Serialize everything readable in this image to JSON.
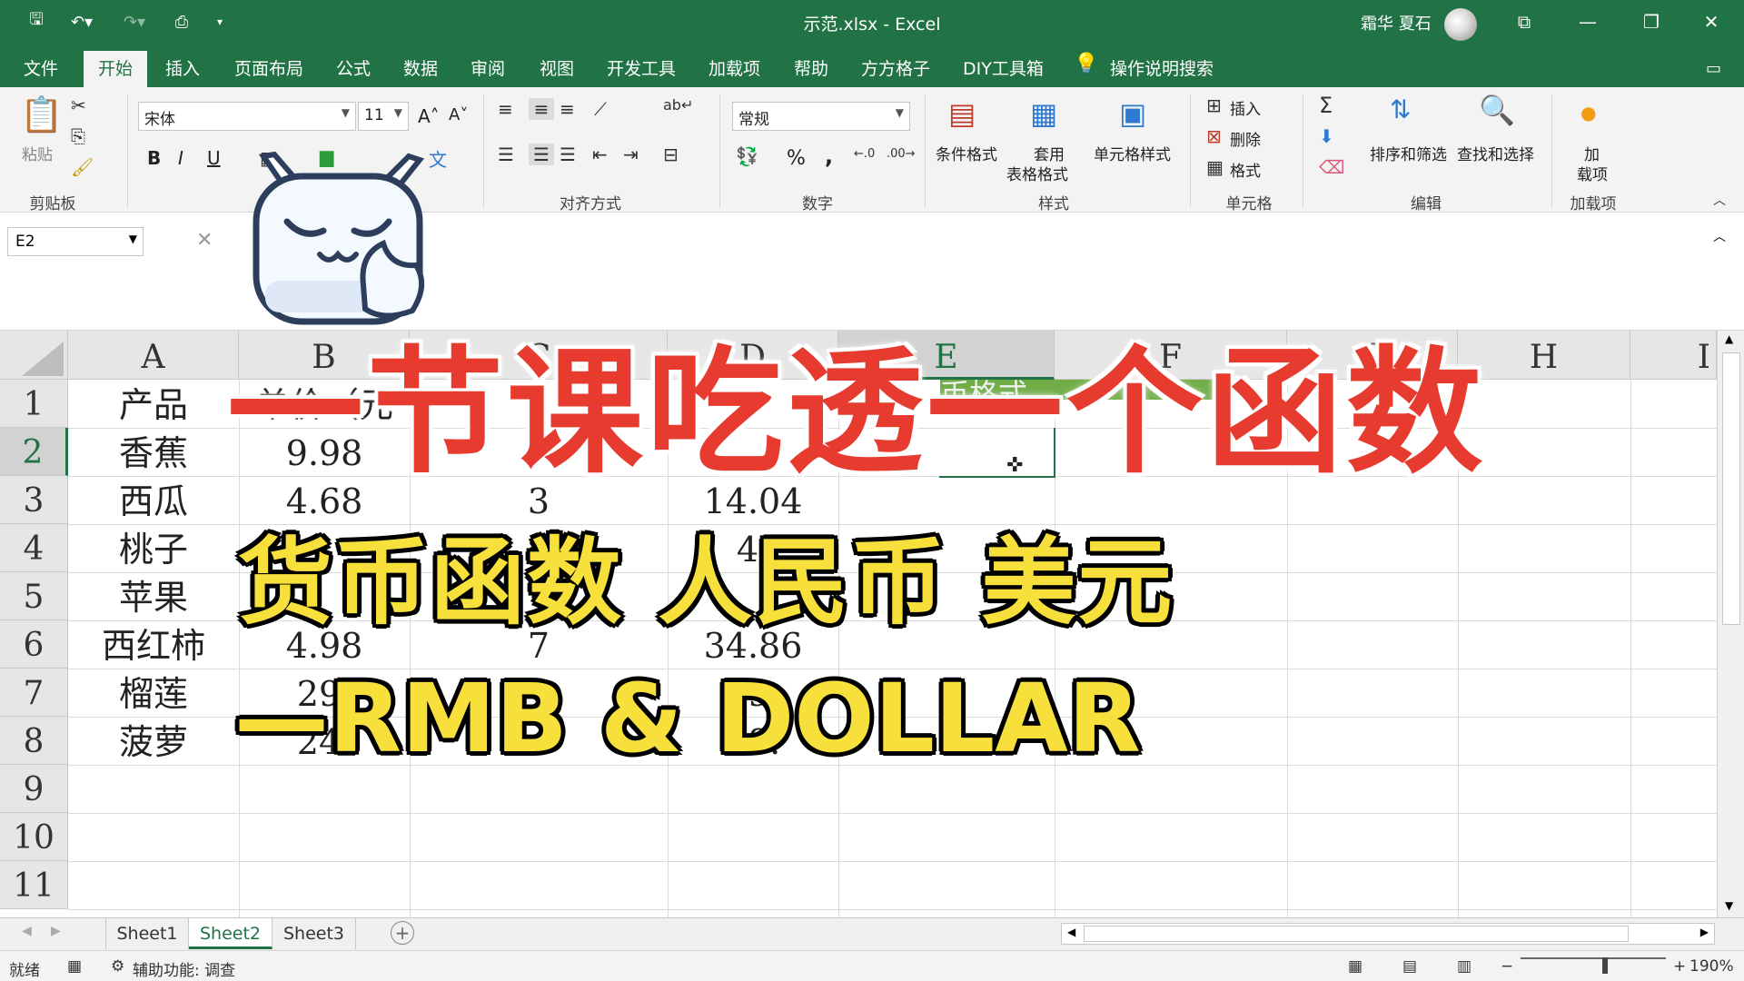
{
  "titlebar": {
    "title": "示范.xlsx  -  Excel",
    "user_name": "霜华 夏石",
    "quick_access": [
      "save-icon",
      "undo-icon",
      "redo-icon",
      "print-preview-icon",
      "customize-icon"
    ],
    "window_controls": [
      "ribbon-display-icon",
      "minimize-icon",
      "restore-icon",
      "close-icon"
    ]
  },
  "tabs": [
    {
      "label": "文件"
    },
    {
      "label": "开始"
    },
    {
      "label": "插入"
    },
    {
      "label": "页面布局"
    },
    {
      "label": "公式"
    },
    {
      "label": "数据"
    },
    {
      "label": "审阅"
    },
    {
      "label": "视图"
    },
    {
      "label": "开发工具"
    },
    {
      "label": "加载项"
    },
    {
      "label": "帮助"
    },
    {
      "label": "方方格子"
    },
    {
      "label": "DIY工具箱"
    },
    {
      "label": "操作说明搜索"
    }
  ],
  "ribbon": {
    "paste_label": "粘贴",
    "font_name": "宋体",
    "font_size": "11",
    "number_format": "常规",
    "conditional_format": "条件格式",
    "table_format_line1": "套用",
    "table_format_line2": "表格格式",
    "cell_styles": "单元格样式",
    "insert": "插入",
    "delete": "删除",
    "format": "格式",
    "sort_filter": "排序和筛选",
    "find_select": "查找和选择",
    "addin_line1": "加",
    "addin_line2": "载项",
    "groups": {
      "clipboard": "剪贴板",
      "alignment": "对齐方式",
      "number": "数字",
      "styles": "样式",
      "cells": "单元格",
      "editing": "编辑",
      "addins": "加载项"
    },
    "bold": "B",
    "italic": "I",
    "underline": "U",
    "percent": "%",
    "comma": ","
  },
  "formula_bar": {
    "name_box": "E2",
    "content": ""
  },
  "grid": {
    "columns": [
      "A",
      "B",
      "C",
      "D",
      "E",
      "F",
      "G",
      "H",
      "I"
    ],
    "selected_column": "E",
    "selected_row": "2",
    "rows": [
      "1",
      "2",
      "3",
      "4",
      "5",
      "6",
      "7",
      "8",
      "9",
      "10",
      "11"
    ],
    "cells": {
      "A": [
        "产品",
        "香蕉",
        "西瓜",
        "桃子",
        "苹果",
        "西红柿",
        "榴莲",
        "菠萝"
      ],
      "B": [
        "单价（元",
        "9.98",
        "4.68",
        "",
        "",
        "4.98",
        "29.",
        "24."
      ],
      "C": [
        "",
        "",
        "3",
        "",
        "",
        "7",
        "",
        ""
      ],
      "D": [
        "",
        "",
        "14.04",
        "4.",
        "",
        "34.86",
        "59.",
        "98."
      ],
      "E1": "币格式"
    }
  },
  "sheets": [
    {
      "label": "Sheet1",
      "active": false
    },
    {
      "label": "Sheet2",
      "active": true
    },
    {
      "label": "Sheet3",
      "active": false
    }
  ],
  "status": {
    "ready": "就绪",
    "accessibility": "辅助功能: 调查",
    "zoom": "190%"
  },
  "overlay": {
    "title": "一节课吃透一个函数",
    "subtitle1": "货币函数 人民币 美元",
    "subtitle2": "—RMB & DOLLAR"
  },
  "colors": {
    "excel_green": "#217346",
    "title_red": "#e63b2e",
    "subtitle_yellow": "#f7e03c",
    "cell_fill_green": "#70ad47"
  }
}
